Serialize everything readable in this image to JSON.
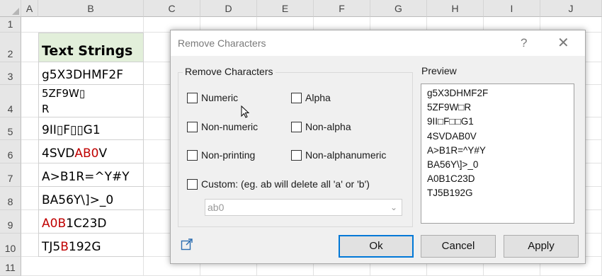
{
  "spreadsheet": {
    "columns": [
      "A",
      "B",
      "C",
      "D",
      "E",
      "F",
      "G",
      "H",
      "I",
      "J"
    ],
    "rows": [
      "1",
      "2",
      "3",
      "4",
      "5",
      "6",
      "7",
      "8",
      "9",
      "10",
      "11"
    ],
    "header_cell": "Text Strings",
    "cells": [
      {
        "segments": [
          {
            "t": "g5X3DHMF2F",
            "red": false
          }
        ]
      },
      {
        "line1": "5ZF9W▯",
        "line2": "R"
      },
      {
        "segments": [
          {
            "t": "9II▯F▯▯G1",
            "red": false
          }
        ]
      },
      {
        "segments": [
          {
            "t": "4SVD",
            "red": false
          },
          {
            "t": "AB0",
            "red": true
          },
          {
            "t": "V",
            "red": false
          }
        ]
      },
      {
        "segments": [
          {
            "t": "A>B1R=^Y#Y",
            "red": false
          }
        ]
      },
      {
        "segments": [
          {
            "t": "BA56Y\\]>_0",
            "red": false
          }
        ]
      },
      {
        "segments": [
          {
            "t": "A0B",
            "red": true
          },
          {
            "t": "1C23D",
            "red": false
          }
        ]
      },
      {
        "segments": [
          {
            "t": "TJ5",
            "red": false
          },
          {
            "t": "B",
            "red": true
          },
          {
            "t": "192G",
            "red": false
          }
        ]
      }
    ]
  },
  "dialog": {
    "title": "Remove Characters",
    "help": "?",
    "close": "✕",
    "remove_group_label": "Remove Characters",
    "options": {
      "numeric": "Numeric",
      "alpha": "Alpha",
      "non_numeric": "Non-numeric",
      "non_alpha": "Non-alpha",
      "non_printing": "Non-printing",
      "non_alphanumeric": "Non-alphanumeric",
      "custom": "Custom: (eg. ab will delete all 'a' or 'b')"
    },
    "custom_value": "ab0",
    "preview_label": "Preview",
    "preview_lines": [
      "g5X3DHMF2F",
      "5ZF9W□R",
      "9II□F□□G1",
      "4SVDAB0V",
      "A>B1R=^Y#Y",
      "BA56Y\\]>_0",
      "A0B1C23D",
      "TJ5B192G"
    ],
    "buttons": {
      "ok": "Ok",
      "cancel": "Cancel",
      "apply": "Apply"
    }
  }
}
